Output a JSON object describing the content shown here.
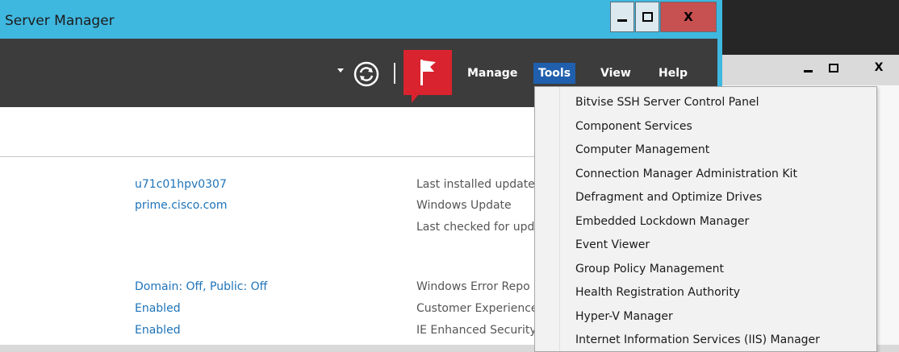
{
  "main_window": {
    "title": "Server Manager",
    "controls": {
      "minimize": "minimize",
      "maximize": "maximize",
      "close": "close"
    }
  },
  "toolbar": {
    "menu": [
      "Manage",
      "Tools",
      "View",
      "Help"
    ],
    "active_menu": "Tools",
    "icons": [
      "dropdown-arrow-icon",
      "refresh-icon",
      "notifications-flag-icon"
    ]
  },
  "server_properties": {
    "left_values": [
      "u71c01hpv0307",
      "prime.cisco.com",
      "Domain: Off, Public: Off",
      "Enabled",
      "Enabled"
    ],
    "right_labels": [
      "Last installed update",
      "Windows Update",
      "Last checked for upd",
      "Windows Error Repo",
      "Customer Experience",
      "IE Enhanced Security"
    ]
  },
  "tools_menu": {
    "items": [
      "Bitvise SSH Server Control Panel",
      "Component Services",
      "Computer Management",
      "Connection Manager Administration Kit",
      "Defragment and Optimize Drives",
      "Embedded Lockdown Manager",
      "Event Viewer",
      "Group Policy Management",
      "Health Registration Authority",
      "Hyper-V Manager",
      "Internet Information Services (IIS) Manager"
    ]
  },
  "colors": {
    "titlebar": "#3fb8e0",
    "toolbar": "#3c3c3c",
    "active_menu": "#1f5fae",
    "link": "#1e73b8",
    "close_button": "#c75050",
    "flag_red": "#d9232e"
  }
}
